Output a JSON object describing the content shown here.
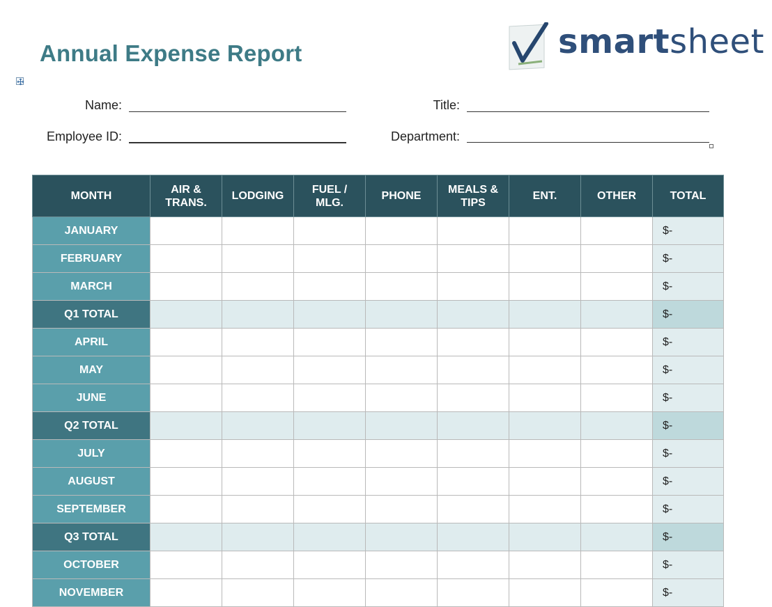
{
  "title": "Annual Expense Report",
  "logo": {
    "text_bold": "smart",
    "text_light": "sheet"
  },
  "form": {
    "name_label": "Name:",
    "title_label": "Title:",
    "employee_id_label": "Employee ID:",
    "department_label": "Department:"
  },
  "table": {
    "headers": [
      "MONTH",
      "AIR & TRANS.",
      "LODGING",
      "FUEL / MLG.",
      "PHONE",
      "MEALS & TIPS",
      "ENT.",
      "OTHER",
      "TOTAL"
    ],
    "rows": [
      {
        "month": "JANUARY",
        "total": "$-",
        "quarter_total": false
      },
      {
        "month": "FEBRUARY",
        "total": "$-",
        "quarter_total": false
      },
      {
        "month": "MARCH",
        "total": "$-",
        "quarter_total": false
      },
      {
        "month": "Q1 TOTAL",
        "total": "$-",
        "quarter_total": true
      },
      {
        "month": "APRIL",
        "total": "$-",
        "quarter_total": false
      },
      {
        "month": "MAY",
        "total": "$-",
        "quarter_total": false
      },
      {
        "month": "JUNE",
        "total": "$-",
        "quarter_total": false
      },
      {
        "month": "Q2 TOTAL",
        "total": "$-",
        "quarter_total": true
      },
      {
        "month": "JULY",
        "total": "$-",
        "quarter_total": false
      },
      {
        "month": "AUGUST",
        "total": "$-",
        "quarter_total": false
      },
      {
        "month": "SEPTEMBER",
        "total": "$-",
        "quarter_total": false
      },
      {
        "month": "Q3 TOTAL",
        "total": "$-",
        "quarter_total": true
      },
      {
        "month": "OCTOBER",
        "total": "$-",
        "quarter_total": false
      },
      {
        "month": "NOVEMBER",
        "total": "$-",
        "quarter_total": false
      }
    ]
  },
  "colors": {
    "title": "#3e7b86",
    "header_bg": "#2b525d",
    "month_bg": "#5a9fab",
    "quarter_bg": "#3f7581",
    "total_bg": "#e1edef",
    "quarter_row_bg": "#dfecee",
    "logo_text": "#2f4f7a"
  },
  "icons": [
    "table-move-handle-icon",
    "checkmark-logo-icon"
  ]
}
